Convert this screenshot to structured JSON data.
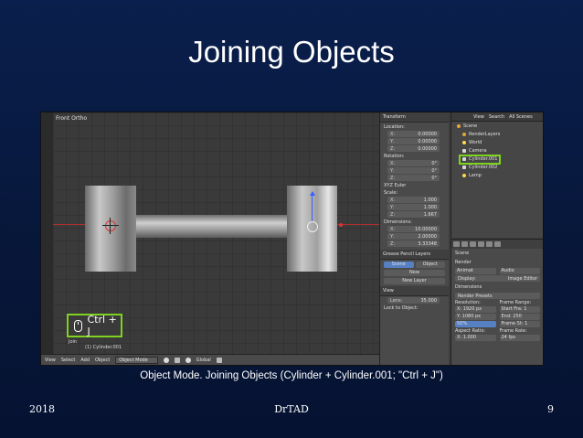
{
  "slide": {
    "title": "Joining Objects",
    "caption": "Object Mode. Joining Objects (Cylinder + Cylinder.001; \"Ctrl + J\")",
    "footer_left": "2018",
    "footer_center": "DrTAD",
    "footer_right": "9"
  },
  "colors": {
    "background": "#0a1f4d",
    "highlight_green": "#7ed321"
  },
  "viewport": {
    "label": "Front Ortho",
    "shortcut": "Ctrl + J",
    "operator_name": "Join",
    "operator_value": "(1) Cylinder.001"
  },
  "header_bar": {
    "view": "View",
    "select": "Select",
    "add": "Add",
    "object": "Object",
    "mode": "Object Mode",
    "global": "Global"
  },
  "npanel": {
    "transform": "Transform",
    "location": "Location:",
    "rotation": "Rotation:",
    "rotation_mode": "XYZ Euler",
    "scale": "Scale:",
    "dimensions": "Dimensions:",
    "loc": [
      {
        "axis": "X:",
        "value": "0.00000"
      },
      {
        "axis": "Y:",
        "value": "0.00000"
      },
      {
        "axis": "Z:",
        "value": "0.00000"
      }
    ],
    "rot": [
      {
        "axis": "X:",
        "value": "0°"
      },
      {
        "axis": "Y:",
        "value": "0°"
      },
      {
        "axis": "Z:",
        "value": "0°"
      }
    ],
    "scl": [
      {
        "axis": "X:",
        "value": "1.000"
      },
      {
        "axis": "Y:",
        "value": "1.000"
      },
      {
        "axis": "Z:",
        "value": "1.667"
      }
    ],
    "dim": [
      {
        "axis": "X:",
        "value": "10.00000"
      },
      {
        "axis": "Y:",
        "value": "2.00000"
      },
      {
        "axis": "Z:",
        "value": "3.33348"
      }
    ],
    "grease_pencil": "Grease Pencil Layers",
    "scene_tab": "Scene",
    "object_tab": "Object",
    "new": "New",
    "new_layer": "New Layer",
    "view_section": "View",
    "lens_label": "Lens:",
    "lens_value": "35.000",
    "lock_to_object": "Lock to Object:"
  },
  "outliner": {
    "tabs": [
      "View",
      "Search",
      "All Scenes"
    ],
    "rows": [
      {
        "label": "Scene",
        "kind": "scene"
      },
      {
        "label": "RenderLayers",
        "kind": "scene"
      },
      {
        "label": "World",
        "kind": "light"
      },
      {
        "label": "Camera",
        "kind": "mesh"
      },
      {
        "label": "Cylinder.001",
        "kind": "mesh"
      },
      {
        "label": "Cylinder.002",
        "kind": "mesh"
      },
      {
        "label": "Lamp",
        "kind": "light"
      }
    ]
  },
  "properties": {
    "scene": "Scene",
    "render": "Render",
    "animation": "Animat",
    "audio": "Audio",
    "display": "Display:",
    "image_editor": "Image Editor",
    "dimensions": "Dimensions",
    "render_presets": "Render Presets",
    "resolution": "Resolution:",
    "frame_range": "Frame Range:",
    "res_x": "X: 1920 px",
    "start": "Start Fra: 1",
    "res_y": "Y: 1080 px",
    "end": "End: 250",
    "percent": "50%",
    "step": "Frame St: 1",
    "aspect": "Aspect Ratio:",
    "frame_rate": "Frame Rate:",
    "aspect_x": "X: 1.000",
    "fps": "24 fps"
  }
}
